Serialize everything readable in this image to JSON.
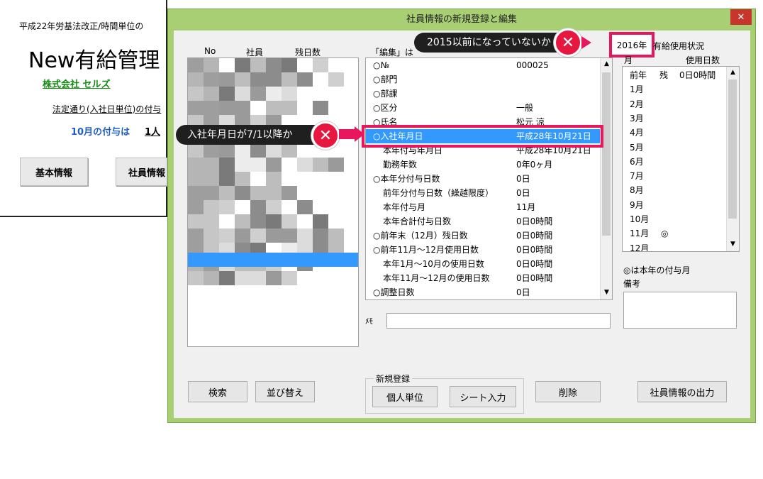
{
  "background_sheet": {
    "header_text": "平成22年労基法改正/時間単位の",
    "app_title": "New有給管理",
    "company": "株式会社 セルズ",
    "rule_text": "法定通り(入社日単位)の付与",
    "grant_text": "10月の付与は",
    "grant_count": "1人",
    "btn_basic": "基本情報",
    "btn_employee": "社員情報"
  },
  "dialog": {
    "title": "社員情報の新規登録と編集",
    "close_glyph": "✕",
    "employee_list": {
      "col_no": "No",
      "col_name": "社員",
      "col_remaining": "残日数"
    },
    "edit_header": "「編集」は",
    "fields": [
      {
        "label": "○№",
        "value": "000025"
      },
      {
        "label": "○部門",
        "value": ""
      },
      {
        "label": "○部課",
        "value": ""
      },
      {
        "label": "○区分",
        "value": "一般"
      },
      {
        "label": "○氏名",
        "value": "松元 涼"
      },
      {
        "label": "○入社年月日",
        "value": "平成28年10月21日"
      },
      {
        "label": "本年付与年月日",
        "value": "平成28年10月21日"
      },
      {
        "label": "勤務年数",
        "value": "0年0ヶ月"
      },
      {
        "label": "○本年分付与日数",
        "value": "0日"
      },
      {
        "label": "前年分付与日数（繰越限度）",
        "value": "0日"
      },
      {
        "label": "本年付与月",
        "value": "11月"
      },
      {
        "label": "本年合計付与日数",
        "value": "0日0時間"
      },
      {
        "label": "○前年末（12月）残日数",
        "value": "0日0時間"
      },
      {
        "label": "○前年11月～12月使用日数",
        "value": "0日0時間"
      },
      {
        "label": "本年1月～10月の使用日数",
        "value": "0日0時間"
      },
      {
        "label": "本年11月～12月の使用日数",
        "value": "0日0時間"
      },
      {
        "label": "○調整日数",
        "value": "0日"
      }
    ],
    "memo_label": "ﾒﾓ",
    "memo_value": "",
    "usage": {
      "year": "2016年",
      "title": "有給使用状況",
      "col_month": "月",
      "col_used": "使用日数",
      "rows": [
        {
          "month": "前年",
          "mark": "残",
          "value": "0日0時間"
        },
        {
          "month": "1月",
          "mark": "",
          "value": ""
        },
        {
          "month": "2月",
          "mark": "",
          "value": ""
        },
        {
          "month": "3月",
          "mark": "",
          "value": ""
        },
        {
          "month": "4月",
          "mark": "",
          "value": ""
        },
        {
          "month": "5月",
          "mark": "",
          "value": ""
        },
        {
          "month": "6月",
          "mark": "",
          "value": ""
        },
        {
          "month": "7月",
          "mark": "",
          "value": ""
        },
        {
          "month": "8月",
          "mark": "",
          "value": ""
        },
        {
          "month": "9月",
          "mark": "",
          "value": ""
        },
        {
          "month": "10月",
          "mark": "",
          "value": ""
        },
        {
          "month": "11月",
          "mark": "◎",
          "value": ""
        },
        {
          "month": "12月",
          "mark": "",
          "value": ""
        }
      ],
      "note": "◎は本年の付与月",
      "remarks_label": "備考",
      "remarks_value": ""
    },
    "buttons": {
      "search": "検索",
      "sort": "並び替え",
      "new_group": "新規登録",
      "individual": "個人単位",
      "sheet_input": "シート入力",
      "delete": "削除",
      "export": "社員情報の出力"
    }
  },
  "callouts": {
    "year_check": "2015以前になっていないか",
    "hire_check": "入社年月日が7/1以降か"
  },
  "colors": {
    "dialog_frame": "#a8cf74",
    "selection": "#3399ff",
    "highlight": "#e8175d",
    "close": "#c7352b"
  }
}
